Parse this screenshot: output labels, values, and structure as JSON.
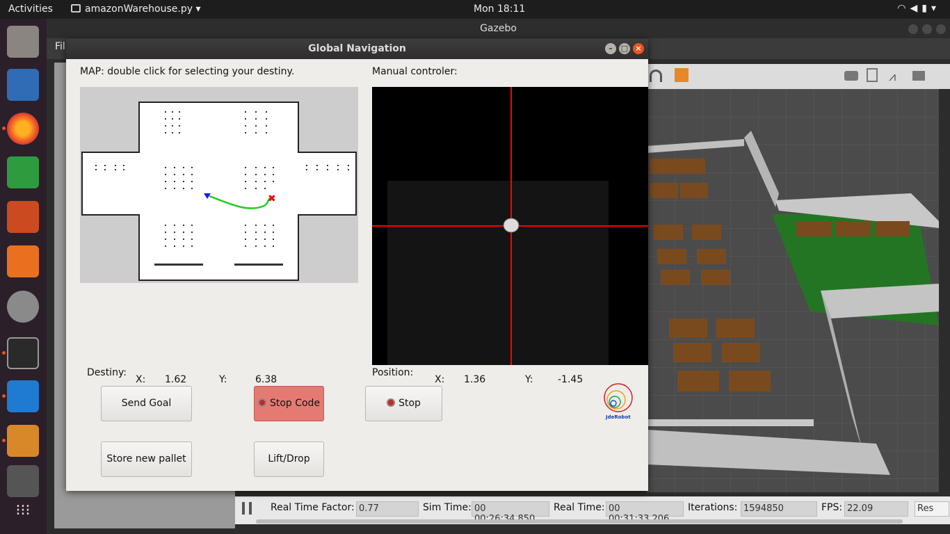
{
  "topbar": {
    "activities": "Activities",
    "app_name": "amazonWarehouse.py",
    "clock": "Mon 18:11"
  },
  "gazebo": {
    "title": "Gazebo",
    "menu_file": "Fil",
    "bottom": {
      "rtf_label": "Real Time Factor:",
      "rtf_value": "0.77",
      "sim_time_label": "Sim Time:",
      "sim_time_value": "00 00:26:34.850",
      "real_time_label": "Real Time:",
      "real_time_value": "00 00:31:33.206",
      "iterations_label": "Iterations:",
      "iterations_value": "1594850",
      "fps_label": "FPS:",
      "fps_value": "22.09",
      "reset_label": "Res"
    }
  },
  "dialog": {
    "title": "Global Navigation",
    "map_label": "MAP: double click for selecting your destiny.",
    "manual_label": "Manual controler:",
    "destiny_label": "Destiny:",
    "destiny_x_label": "X:",
    "destiny_x": "1.62",
    "destiny_y_label": "Y:",
    "destiny_y": "6.38",
    "position_label": "Position:",
    "position_x_label": "X:",
    "position_x": "1.36",
    "position_y_label": "Y:",
    "position_y": "-1.45",
    "buttons": {
      "send_goal": "Send Goal",
      "stop_code": "Stop Code",
      "stop": "Stop",
      "store_pallet": "Store new pallet",
      "lift_drop": "Lift/Drop"
    },
    "logo_text": "JdeRobot"
  },
  "colors": {
    "accent": "#e95420",
    "stop_code_bg": "#e57a73",
    "crosshair": "#ff0000",
    "path": "#22cc22"
  }
}
